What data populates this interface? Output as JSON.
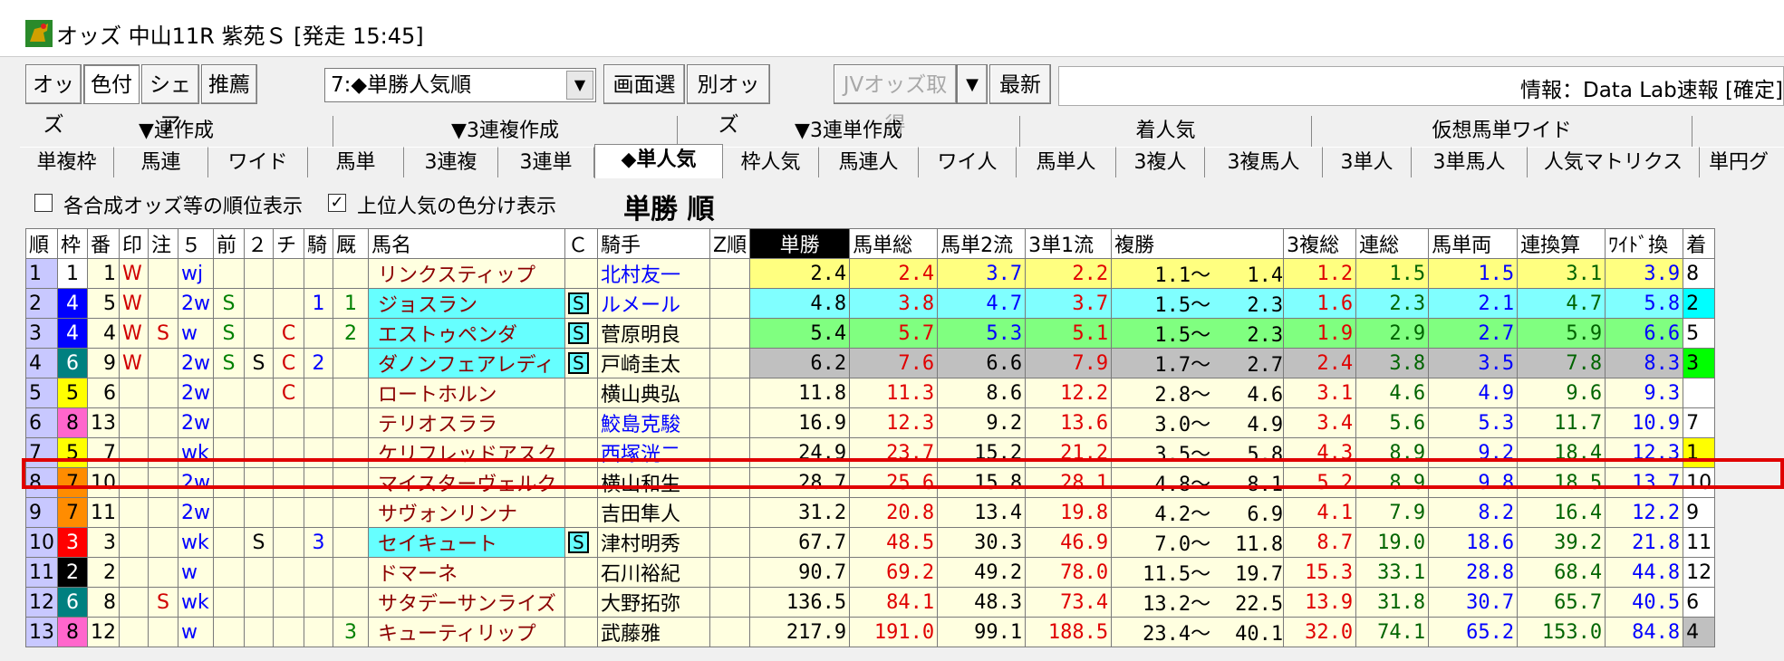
{
  "window": {
    "title": "オッズ 中山11R 紫苑Ｓ [発走 15:45]"
  },
  "toolbar": {
    "buttons": [
      "オッズ",
      "色付",
      "シェア",
      "推薦"
    ],
    "dropdown_value": "7:◆単勝人気順",
    "screen_btn": "画面選",
    "other_odds_btn": "別オッズ",
    "jv_btn": "JVオッズ取得",
    "latest_btn": "最新",
    "info_text": "情報：Data Lab速報 [確定]"
  },
  "tabs_top": [
    "▼連作成",
    "▼3連複作成",
    "▼3連単作成",
    "着人気",
    "仮想馬単ワイド"
  ],
  "tabs_bottom": [
    "単複枠",
    "馬連",
    "ワイド",
    "馬単",
    "3連複",
    "3連単",
    "◆単人気",
    "枠人気",
    "馬連人",
    "ワイ人",
    "馬単人",
    "3複人",
    "3複馬人",
    "3単人",
    "3単馬人",
    "人気マトリクス",
    "単円グ"
  ],
  "options": {
    "opt1_label": "各合成オッズ等の順位表示",
    "opt1_checked": "",
    "opt2_label": "上位人気の色分け表示",
    "opt2_checked": "✓",
    "heading": "単勝 順"
  },
  "headers": [
    "順",
    "枠",
    "番",
    "印",
    "注",
    "５",
    "前",
    "２",
    "チ",
    "騎",
    "厩",
    "馬名",
    "Ｃ",
    "騎手",
    "Z順",
    "単勝",
    "馬単総",
    "馬単2流",
    "3単1流",
    "複勝",
    "3複総",
    "連総",
    "馬単両",
    "連換算",
    "ﾜｲﾄﾞ換",
    "着"
  ],
  "rows": [
    {
      "rank": "1",
      "waku": "1",
      "ban": "1",
      "in": "W",
      "chu": "",
      "c5": "wj",
      "mae": "",
      "c2": "",
      "chi": "",
      "ki": "",
      "kyu": "",
      "name": "リンクスティップ",
      "c": "",
      "jockey": "北村友一",
      "z": "",
      "tan": "2.4",
      "bt": "2.4",
      "b2": "3.7",
      "s1": "2.2",
      "fmin": "1.1～",
      "fmax": "1.4",
      "t3": "1.2",
      "rt": "1.5",
      "bl": "1.5",
      "rk": "3.1",
      "wk": "3.9",
      "chaku": "8"
    },
    {
      "rank": "2",
      "waku": "4",
      "ban": "5",
      "in": "W",
      "chu": "",
      "c5": "2w",
      "mae": "S",
      "c2": "",
      "chi": "",
      "ki": "1",
      "kyu": "1",
      "name": "ジョスラン",
      "c": "S",
      "jockey": "ルメール",
      "z": "",
      "tan": "4.8",
      "bt": "3.8",
      "b2": "4.7",
      "s1": "3.7",
      "fmin": "1.5～",
      "fmax": "2.3",
      "t3": "1.6",
      "rt": "2.3",
      "bl": "2.1",
      "rk": "4.7",
      "wk": "5.8",
      "chaku": "2"
    },
    {
      "rank": "3",
      "waku": "4",
      "ban": "4",
      "in": "W",
      "chu": "S",
      "c5": "w",
      "mae": "S",
      "c2": "",
      "chi": "C",
      "ki": "",
      "kyu": "2",
      "name": "エストゥペンダ",
      "c": "S",
      "jockey": "菅原明良",
      "z": "",
      "tan": "5.4",
      "bt": "5.7",
      "b2": "5.3",
      "s1": "5.1",
      "fmin": "1.5～",
      "fmax": "2.3",
      "t3": "1.9",
      "rt": "2.9",
      "bl": "2.7",
      "rk": "5.9",
      "wk": "6.6",
      "chaku": "5"
    },
    {
      "rank": "4",
      "waku": "6",
      "ban": "9",
      "in": "W",
      "chu": "",
      "c5": "2w",
      "mae": "S",
      "c2": "S",
      "chi": "C",
      "ki": "2",
      "kyu": "",
      "name": "ダノンフェアレディ",
      "c": "S",
      "jockey": "戸崎圭太",
      "z": "",
      "tan": "6.2",
      "bt": "7.6",
      "b2": "6.6",
      "s1": "7.9",
      "fmin": "1.7～",
      "fmax": "2.7",
      "t3": "2.4",
      "rt": "3.8",
      "bl": "3.5",
      "rk": "7.8",
      "wk": "8.3",
      "chaku": "3"
    },
    {
      "rank": "5",
      "waku": "5",
      "ban": "6",
      "in": "",
      "chu": "",
      "c5": "2w",
      "mae": "",
      "c2": "",
      "chi": "C",
      "ki": "",
      "kyu": "",
      "name": "ロートホルン",
      "c": "",
      "jockey": "横山典弘",
      "z": "",
      "tan": "11.8",
      "bt": "11.3",
      "b2": "8.6",
      "s1": "12.2",
      "fmin": "2.8～",
      "fmax": "4.6",
      "t3": "3.1",
      "rt": "4.6",
      "bl": "4.9",
      "rk": "9.6",
      "wk": "9.3",
      "chaku": ""
    },
    {
      "rank": "6",
      "waku": "8",
      "ban": "13",
      "in": "",
      "chu": "",
      "c5": "2w",
      "mae": "",
      "c2": "",
      "chi": "",
      "ki": "",
      "kyu": "",
      "name": "テリオスララ",
      "c": "",
      "jockey": "鮫島克駿",
      "z": "",
      "tan": "16.9",
      "bt": "12.3",
      "b2": "9.2",
      "s1": "13.6",
      "fmin": "3.0～",
      "fmax": "4.9",
      "t3": "3.4",
      "rt": "5.6",
      "bl": "5.3",
      "rk": "11.7",
      "wk": "10.9",
      "chaku": "7"
    },
    {
      "rank": "7",
      "waku": "5",
      "ban": "7",
      "in": "",
      "chu": "",
      "c5": "wk",
      "mae": "",
      "c2": "",
      "chi": "",
      "ki": "",
      "kyu": "",
      "name": "ケリフレッドアスク",
      "c": "",
      "jockey": "西塚洸二",
      "z": "",
      "tan": "24.9",
      "bt": "23.7",
      "b2": "15.2",
      "s1": "21.2",
      "fmin": "3.5～",
      "fmax": "5.8",
      "t3": "4.3",
      "rt": "8.9",
      "bl": "9.2",
      "rk": "18.4",
      "wk": "12.3",
      "chaku": "1"
    },
    {
      "rank": "8",
      "waku": "7",
      "ban": "10",
      "in": "",
      "chu": "",
      "c5": "2w",
      "mae": "",
      "c2": "",
      "chi": "",
      "ki": "",
      "kyu": "",
      "name": "マイスターヴェルク",
      "c": "",
      "jockey": "横山和生",
      "z": "",
      "tan": "28.7",
      "bt": "25.6",
      "b2": "15.8",
      "s1": "28.1",
      "fmin": "4.8～",
      "fmax": "8.1",
      "t3": "5.2",
      "rt": "8.9",
      "bl": "9.8",
      "rk": "18.5",
      "wk": "13.7",
      "chaku": "10"
    },
    {
      "rank": "9",
      "waku": "7",
      "ban": "11",
      "in": "",
      "chu": "",
      "c5": "2w",
      "mae": "",
      "c2": "",
      "chi": "",
      "ki": "",
      "kyu": "",
      "name": "サヴォンリンナ",
      "c": "",
      "jockey": "吉田隼人",
      "z": "",
      "tan": "31.2",
      "bt": "20.8",
      "b2": "13.4",
      "s1": "19.8",
      "fmin": "4.2～",
      "fmax": "6.9",
      "t3": "4.1",
      "rt": "7.9",
      "bl": "8.2",
      "rk": "16.4",
      "wk": "12.2",
      "chaku": "9"
    },
    {
      "rank": "10",
      "waku": "3",
      "ban": "3",
      "in": "",
      "chu": "",
      "c5": "wk",
      "mae": "",
      "c2": "S",
      "chi": "",
      "ki": "3",
      "kyu": "",
      "name": "セイキュート",
      "c": "S",
      "jockey": "津村明秀",
      "z": "",
      "tan": "67.7",
      "bt": "48.5",
      "b2": "30.3",
      "s1": "46.9",
      "fmin": "7.0～",
      "fmax": "11.8",
      "t3": "8.7",
      "rt": "19.0",
      "bl": "18.6",
      "rk": "39.2",
      "wk": "21.8",
      "chaku": "11"
    },
    {
      "rank": "11",
      "waku": "2",
      "ban": "2",
      "in": "",
      "chu": "",
      "c5": "w",
      "mae": "",
      "c2": "",
      "chi": "",
      "ki": "",
      "kyu": "",
      "name": "ドマーネ",
      "c": "",
      "jockey": "石川裕紀",
      "z": "",
      "tan": "90.7",
      "bt": "69.2",
      "b2": "49.2",
      "s1": "78.0",
      "fmin": "11.5～",
      "fmax": "19.7",
      "t3": "15.3",
      "rt": "33.1",
      "bl": "28.8",
      "rk": "68.4",
      "wk": "44.8",
      "chaku": "12"
    },
    {
      "rank": "12",
      "waku": "6",
      "ban": "8",
      "in": "",
      "chu": "S",
      "c5": "wk",
      "mae": "",
      "c2": "",
      "chi": "",
      "ki": "",
      "kyu": "",
      "name": "サタデーサンライズ",
      "c": "",
      "jockey": "大野拓弥",
      "z": "",
      "tan": "136.5",
      "bt": "84.1",
      "b2": "48.3",
      "s1": "73.4",
      "fmin": "13.2～",
      "fmax": "22.5",
      "t3": "13.9",
      "rt": "31.8",
      "bl": "30.7",
      "rk": "65.7",
      "wk": "40.5",
      "chaku": "6"
    },
    {
      "rank": "13",
      "waku": "8",
      "ban": "12",
      "in": "",
      "chu": "",
      "c5": "w",
      "mae": "",
      "c2": "",
      "chi": "",
      "ki": "",
      "kyu": "3",
      "name": "キューティリップ",
      "c": "",
      "jockey": "武藤雅",
      "z": "",
      "tan": "217.9",
      "bt": "191.0",
      "b2": "99.1",
      "s1": "188.5",
      "fmin": "23.4～",
      "fmax": "40.1",
      "t3": "32.0",
      "rt": "74.1",
      "bl": "65.2",
      "rk": "153.0",
      "wk": "84.8",
      "chaku": "4"
    }
  ],
  "colors": {
    "waku": {
      "1": "#ffffff",
      "2": "#000000",
      "3": "#ff0000",
      "4": "#0000ff",
      "5": "#ffff00",
      "6": "#008080",
      "7": "#ff8c00",
      "8": "#ff66cc"
    },
    "tier1": "#ffff80",
    "tier2": "#80ffff",
    "tier3": "#80ff80",
    "tier4": "#c0c0c0",
    "chaku1": "#ffff00",
    "chaku2": "#00ffff",
    "chaku3": "#00ff00",
    "chaku4": "#c0c0c0"
  }
}
